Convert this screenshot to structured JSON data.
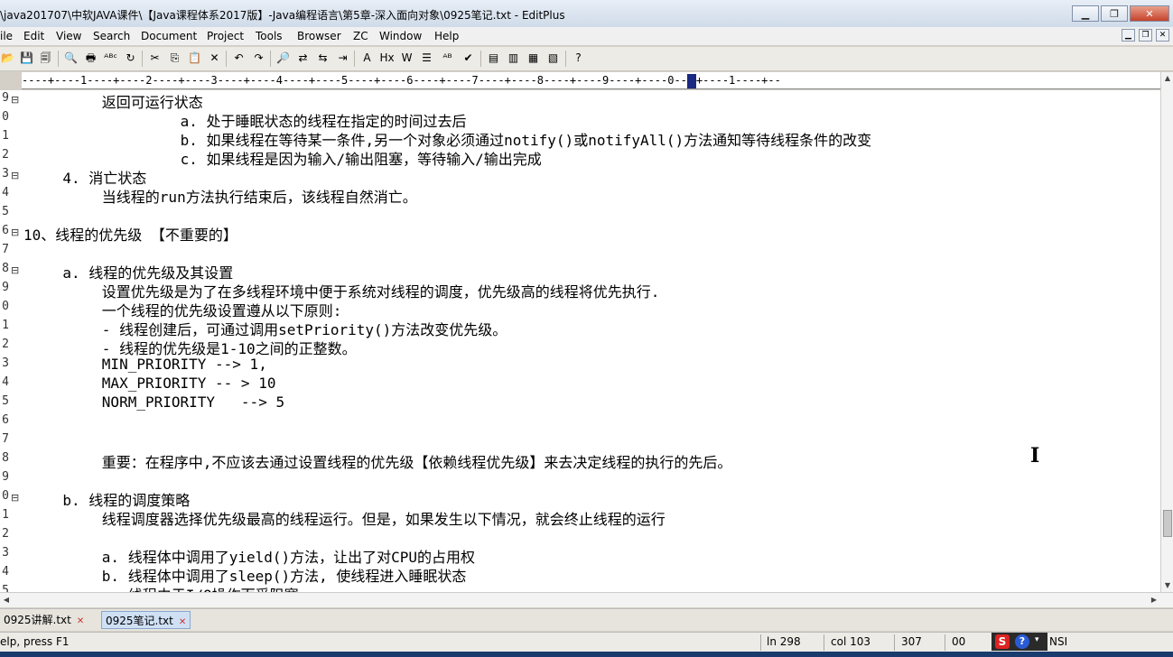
{
  "window": {
    "title": "\\java201707\\中软JAVA课件\\【Java课程体系2017版】-Java编程语言\\第5章-深入面向对象\\0925笔记.txt - EditPlus",
    "minimize": "▁",
    "maximize": "❐",
    "close": "✕"
  },
  "menu": [
    "ile",
    "Edit",
    "View",
    "Search",
    "Document",
    "Project",
    "Tools",
    "Browser",
    "ZC",
    "Window",
    "Help"
  ],
  "mdi_buttons": [
    "▁",
    "❐",
    "✕"
  ],
  "toolbar_icons": [
    "open-folder-icon",
    "save-icon",
    "save-all-icon",
    "print-preview-icon",
    "print-icon",
    "spell-check-icon",
    "reload-icon",
    "cut-icon",
    "copy-icon",
    "paste-icon",
    "delete-icon",
    "undo-icon",
    "redo-icon",
    "find-icon",
    "replace-icon",
    "find-in-files-icon",
    "goto-line-icon",
    "font-icon",
    "hex-icon",
    "word-wrap-icon",
    "line-numbers-icon",
    "column-icon",
    "check-icon",
    "browser-icon",
    "browser2-icon",
    "browser3-icon",
    "browser4-icon",
    "help-cursor-icon"
  ],
  "toolbar_glyphs": [
    "📂",
    "💾",
    "🗐",
    "🔍",
    "🖶",
    "ᴬᴮᶜ",
    "↻",
    "✂",
    "⎘",
    "📋",
    "✕",
    "↶",
    "↷",
    "🔎",
    "⇄",
    "⇆",
    "⇥",
    "A",
    "Hx",
    "W",
    "☰",
    "ᴬᴮ",
    "✔",
    "▤",
    "▥",
    "▦",
    "▧",
    "?"
  ],
  "ruler": {
    "before": "----+----1----+----2----+----3----+----4----+----5----+----6----+----7----+----8----+----9----+----0--",
    "after": "+----1----+--"
  },
  "editor": {
    "lines": [
      {
        "num": "9",
        "fold": "⊟",
        "indent": 8,
        "text": "返回可运行状态"
      },
      {
        "num": "0",
        "fold": "",
        "indent": 16,
        "text": "a. 处于睡眠状态的线程在指定的时间过去后"
      },
      {
        "num": "1",
        "fold": "",
        "indent": 16,
        "text": "b. 如果线程在等待某一条件,另一个对象必须通过notify()或notifyAll()方法通知等待线程条件的改变"
      },
      {
        "num": "2",
        "fold": "",
        "indent": 16,
        "text": "c. 如果线程是因为输入/输出阻塞，等待输入/输出完成"
      },
      {
        "num": "3",
        "fold": "⊟",
        "indent": 4,
        "text": "4. 消亡状态"
      },
      {
        "num": "4",
        "fold": "",
        "indent": 8,
        "text": "当线程的run方法执行结束后，该线程自然消亡。"
      },
      {
        "num": "5",
        "fold": "",
        "indent": 0,
        "text": ""
      },
      {
        "num": "6",
        "fold": "⊟",
        "indent": 0,
        "text": "10、线程的优先级 【不重要的】"
      },
      {
        "num": "7",
        "fold": "",
        "indent": 0,
        "text": ""
      },
      {
        "num": "8",
        "fold": "⊟",
        "indent": 4,
        "text": "a. 线程的优先级及其设置"
      },
      {
        "num": "9",
        "fold": "",
        "indent": 8,
        "text": "设置优先级是为了在多线程环境中便于系统对线程的调度，优先级高的线程将优先执行."
      },
      {
        "num": "0",
        "fold": "",
        "indent": 8,
        "text": "一个线程的优先级设置遵从以下原则:"
      },
      {
        "num": "1",
        "fold": "",
        "indent": 8,
        "text": "- 线程创建后，可通过调用setPriority()方法改变优先级。"
      },
      {
        "num": "2",
        "fold": "",
        "indent": 8,
        "text": "- 线程的优先级是1-10之间的正整数。"
      },
      {
        "num": "3",
        "fold": "",
        "indent": 8,
        "text": "MIN_PRIORITY --> 1,"
      },
      {
        "num": "4",
        "fold": "",
        "indent": 8,
        "text": "MAX_PRIORITY -- > 10"
      },
      {
        "num": "5",
        "fold": "",
        "indent": 8,
        "text": "NORM_PRIORITY   --> 5"
      },
      {
        "num": "6",
        "fold": "",
        "indent": 0,
        "text": ""
      },
      {
        "num": "7",
        "fold": "",
        "indent": 0,
        "text": ""
      },
      {
        "num": "8",
        "fold": "",
        "indent": 8,
        "text": "重要：在程序中,不应该去通过设置线程的优先级【依赖线程优先级】来去决定线程的执行的先后。"
      },
      {
        "num": "9",
        "fold": "",
        "indent": 0,
        "text": ""
      },
      {
        "num": "0",
        "fold": "⊟",
        "indent": 4,
        "text": "b. 线程的调度策略"
      },
      {
        "num": "1",
        "fold": "",
        "indent": 8,
        "text": "线程调度器选择优先级最高的线程运行。但是，如果发生以下情况，就会终止线程的运行"
      },
      {
        "num": "2",
        "fold": "",
        "indent": 0,
        "text": ""
      },
      {
        "num": "3",
        "fold": "",
        "indent": 8,
        "text": "a. 线程体中调用了yield()方法，让出了对CPU的占用权"
      },
      {
        "num": "4",
        "fold": "",
        "indent": 8,
        "text": "b. 线程体中调用了sleep()方法, 使线程进入睡眠状态"
      },
      {
        "num": "5",
        "fold": "",
        "indent": 8,
        "text": "c. 线程由于I/O操作而受阻塞"
      }
    ]
  },
  "tabs": [
    {
      "label": "0925讲解.txt",
      "close": "✕",
      "active": false
    },
    {
      "label": "0925笔记.txt",
      "close": "✕",
      "active": true
    }
  ],
  "statusbar": {
    "help": "elp, press F1",
    "ln": "ln 298",
    "col": "col 103",
    "chars": "307",
    "code": "00",
    "encoding": "NSI"
  },
  "tray": {
    "sogou": "S",
    "help": "?",
    "more": "▾"
  }
}
